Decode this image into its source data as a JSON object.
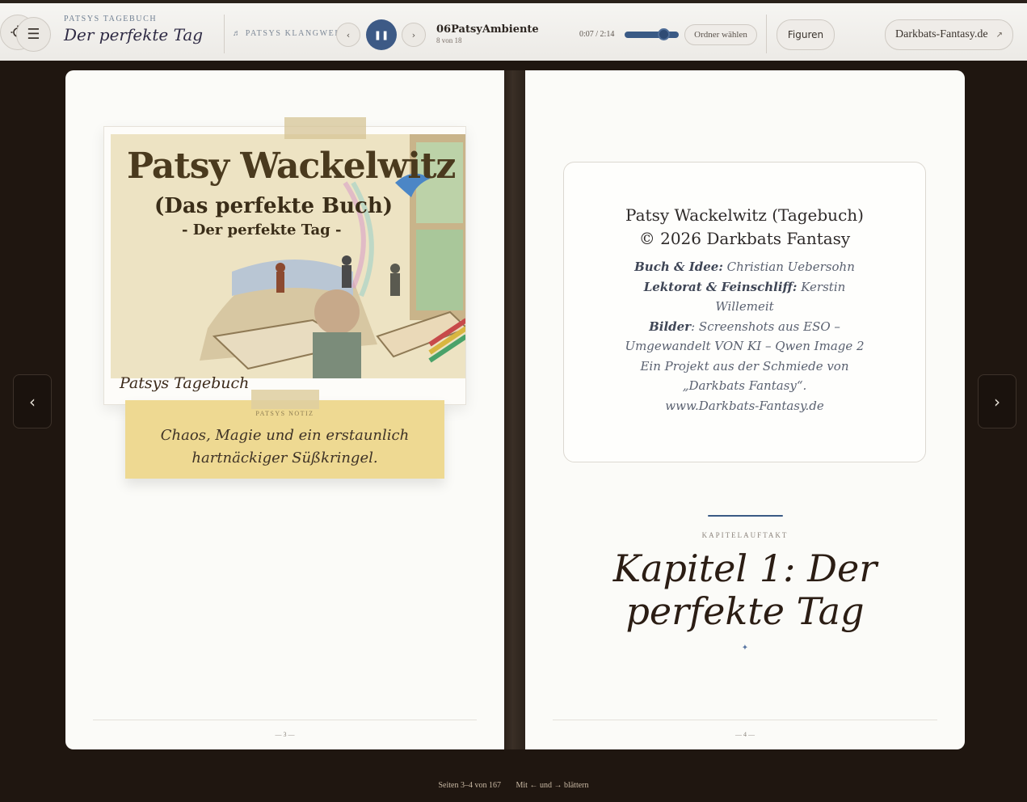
{
  "header": {
    "kicker": "PATSYS TAGEBUCH",
    "title": "Der perfekte Tag",
    "menu_icon": "menu-icon"
  },
  "player": {
    "label": "♬ PATSYS KLANGWELT",
    "prev_glyph": "‹",
    "play_glyph": "❚❚",
    "next_glyph": "›",
    "track_title": "06PatsyAmbiente",
    "track_count": "8 von 18",
    "time": "0:07 / 2:14",
    "progress": 0.78,
    "folder_button": "Ordner wählen"
  },
  "toolbar": {
    "figures_button": "Figuren",
    "settings_icon": "sun-icon",
    "site_button": "Darkbats-Fantasy.de",
    "site_icon": "↗"
  },
  "left_page": {
    "cover_title": "Patsy Wackelwitz",
    "cover_subtitle": "(Das perfekte Buch)",
    "cover_subtitle2": "- Der perfekte Tag -",
    "cover_caption": "Patsys Tagebuch",
    "note_kicker": "PATSYS NOTIZ",
    "note_line1": "Chaos, Magie und ein erstaunlich",
    "note_line2": "hartnäckiger Süßkringel.",
    "page_number": "— 3 —"
  },
  "right_page": {
    "imprint_line1": "Patsy Wackelwitz (Tagebuch)",
    "imprint_line2": "© 2026 Darkbats Fantasy",
    "credits": [
      {
        "label": "Buch & Idee:",
        "value": " Christian Uebersohn"
      },
      {
        "label": "Lektorat & Feinschliff:",
        "value": " Kerstin Willemeit"
      },
      {
        "label": "Bilder",
        "value": ": Screenshots aus ESO – Umgewandelt VON KI – Qwen Image 2"
      }
    ],
    "project_line": "Ein Projekt aus der Schmiede von „Darkbats Fantasy“.",
    "website": "www.Darkbats-Fantasy.de",
    "chapter_kicker": "KAPITELAUFTAKT",
    "chapter_title": "Kapitel 1: Der perfekte Tag",
    "chapter_ornament": "✦",
    "page_number": "— 4 —"
  },
  "navigation": {
    "prev_glyph": "‹",
    "next_glyph": "›"
  },
  "status": {
    "pages": "Seiten 3–4 von 167",
    "hint": "Mit ← und → blättern"
  }
}
